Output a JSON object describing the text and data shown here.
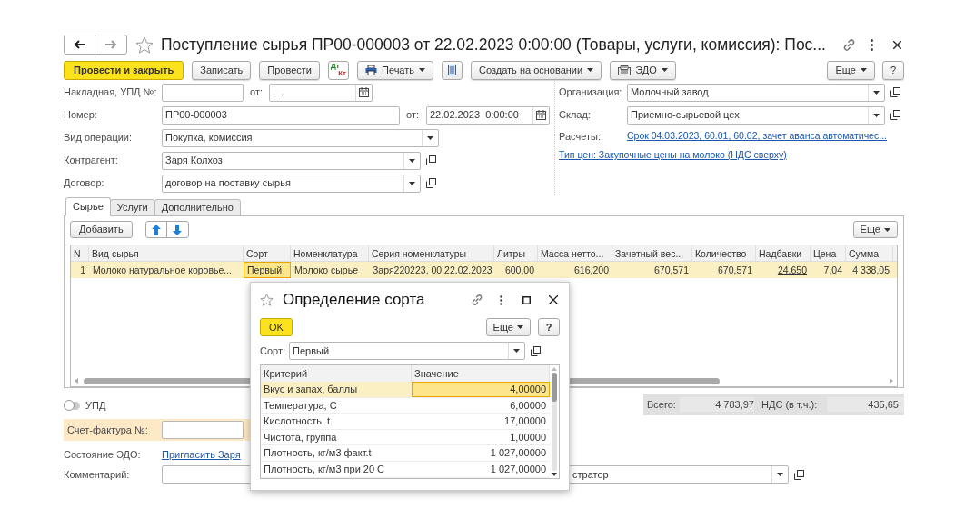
{
  "window": {
    "title": "Поступление сырья ПР00-000003 от 22.02.2023 0:00:00 (Товары, услуги, комиссия): Пос..."
  },
  "toolbar": [
    {
      "kind": "primary",
      "label": "Провести и закрыть"
    },
    {
      "kind": "button",
      "label": "Записать"
    },
    {
      "kind": "button",
      "label": "Провести"
    },
    {
      "kind": "dtkt",
      "label": "Дт",
      "sublabel": "Кт"
    },
    {
      "kind": "print",
      "label": "Печать"
    },
    {
      "kind": "list"
    },
    {
      "kind": "dropdown",
      "label": "Создать на основании"
    },
    {
      "kind": "edo",
      "label": "ЭДО"
    }
  ],
  "toolbar_right": [
    {
      "kind": "dropdown",
      "label": "Еще"
    },
    {
      "kind": "button",
      "label": "?"
    }
  ],
  "left_fields": {
    "invoice": {
      "label": "Накладная, УПД №:",
      "date_label": "от:",
      "date_value": ".  ."
    },
    "number": {
      "label": "Номер:",
      "value": "ПР00-000003",
      "date_label": "от:",
      "date_value": "22.02.2023  0:00:00"
    },
    "operation": {
      "label": "Вид операции:",
      "value": "Покупка, комиссия"
    },
    "counterparty": {
      "label": "Контрагент:",
      "value": "Заря Колхоз"
    },
    "contract": {
      "label": "Договор:",
      "value": "договор на поставку сырья"
    }
  },
  "right_fields": {
    "organization": {
      "label": "Организация:",
      "value": "Молочный завод"
    },
    "warehouse": {
      "label": "Склад:",
      "value": "Приемно-сырьевой цех"
    },
    "settlements": {
      "label": "Расчеты:",
      "link": "Срок 04.03.2023, 60.01, 60.02, зачет аванса автоматичес..."
    },
    "price_type_link": "Тип цен: Закупочные цены на молоко (НДС сверху)"
  },
  "tabs": [
    {
      "label": "Сырье",
      "selected": true
    },
    {
      "label": "Услуги",
      "selected": false
    },
    {
      "label": "Дополнительно",
      "selected": false
    }
  ],
  "table_toolbar": {
    "add": "Добавить",
    "more": "Еще"
  },
  "table": {
    "columns": [
      "N",
      "Вид сырья",
      "Сорт",
      "Номенклатура",
      "Серия номенклатуры",
      "Литры",
      "Масса нетто...",
      "Зачетный вес...",
      "Количество",
      "Надбавки",
      "Цена",
      "Сумма"
    ],
    "rows": [
      {
        "selected": true,
        "cells": [
          {
            "text": "1",
            "kind": "number",
            "current": false
          },
          {
            "text": "Молоко натуральное коровье...",
            "kind": "text",
            "current": false
          },
          {
            "text": "Первый",
            "kind": "text",
            "current": true
          },
          {
            "text": "Молоко сырье",
            "kind": "text",
            "current": false
          },
          {
            "text": "Заря220223, 00.22.02.2023",
            "kind": "text",
            "current": false
          },
          {
            "text": "600,00",
            "kind": "number",
            "current": false
          },
          {
            "text": "616,200",
            "kind": "number",
            "current": false
          },
          {
            "text": "670,571",
            "kind": "number",
            "current": false
          },
          {
            "text": "670,571",
            "kind": "number",
            "current": false
          },
          {
            "text": "24,650",
            "kind": "link",
            "current": false
          },
          {
            "text": "7,04",
            "kind": "number",
            "current": false
          },
          {
            "text": "4 338,05",
            "kind": "number",
            "current": false
          }
        ]
      }
    ]
  },
  "upd": {
    "label": "УПД",
    "on": false
  },
  "totals": [
    {
      "label": "Всего:",
      "value": "4 783,97"
    },
    {
      "label": "НДС (в т.ч.):",
      "value": "435,65"
    }
  ],
  "invoice_field": {
    "label": "Счет-фактура №:"
  },
  "edo_state": {
    "label": "Состояние ЭДО:",
    "link": "Пригласить Заря"
  },
  "comment": {
    "label": "Комментарий:"
  },
  "responsible": {
    "value": "стратор"
  },
  "dialog": {
    "title": "Определение сорта",
    "ok": "OK",
    "more": "Еще",
    "help": "?",
    "sort": {
      "label": "Сорт:",
      "value": "Первый"
    },
    "columns": [
      "Критерий",
      "Значение"
    ],
    "rows": [
      {
        "criterion": "Вкус и запах, баллы",
        "value": "4,00000",
        "selected": true
      },
      {
        "criterion": "Температура, С",
        "value": "6,00000",
        "selected": false
      },
      {
        "criterion": "Кислотность, t",
        "value": "17,00000",
        "selected": false
      },
      {
        "criterion": "Чистота, группа",
        "value": "1,00000",
        "selected": false
      },
      {
        "criterion": "Плотность, кг/м3 факт.t",
        "value": "1 027,00000",
        "selected": false
      },
      {
        "criterion": "Плотность, кг/м3 при 20 С",
        "value": "1 027,00000",
        "selected": false
      }
    ]
  }
}
